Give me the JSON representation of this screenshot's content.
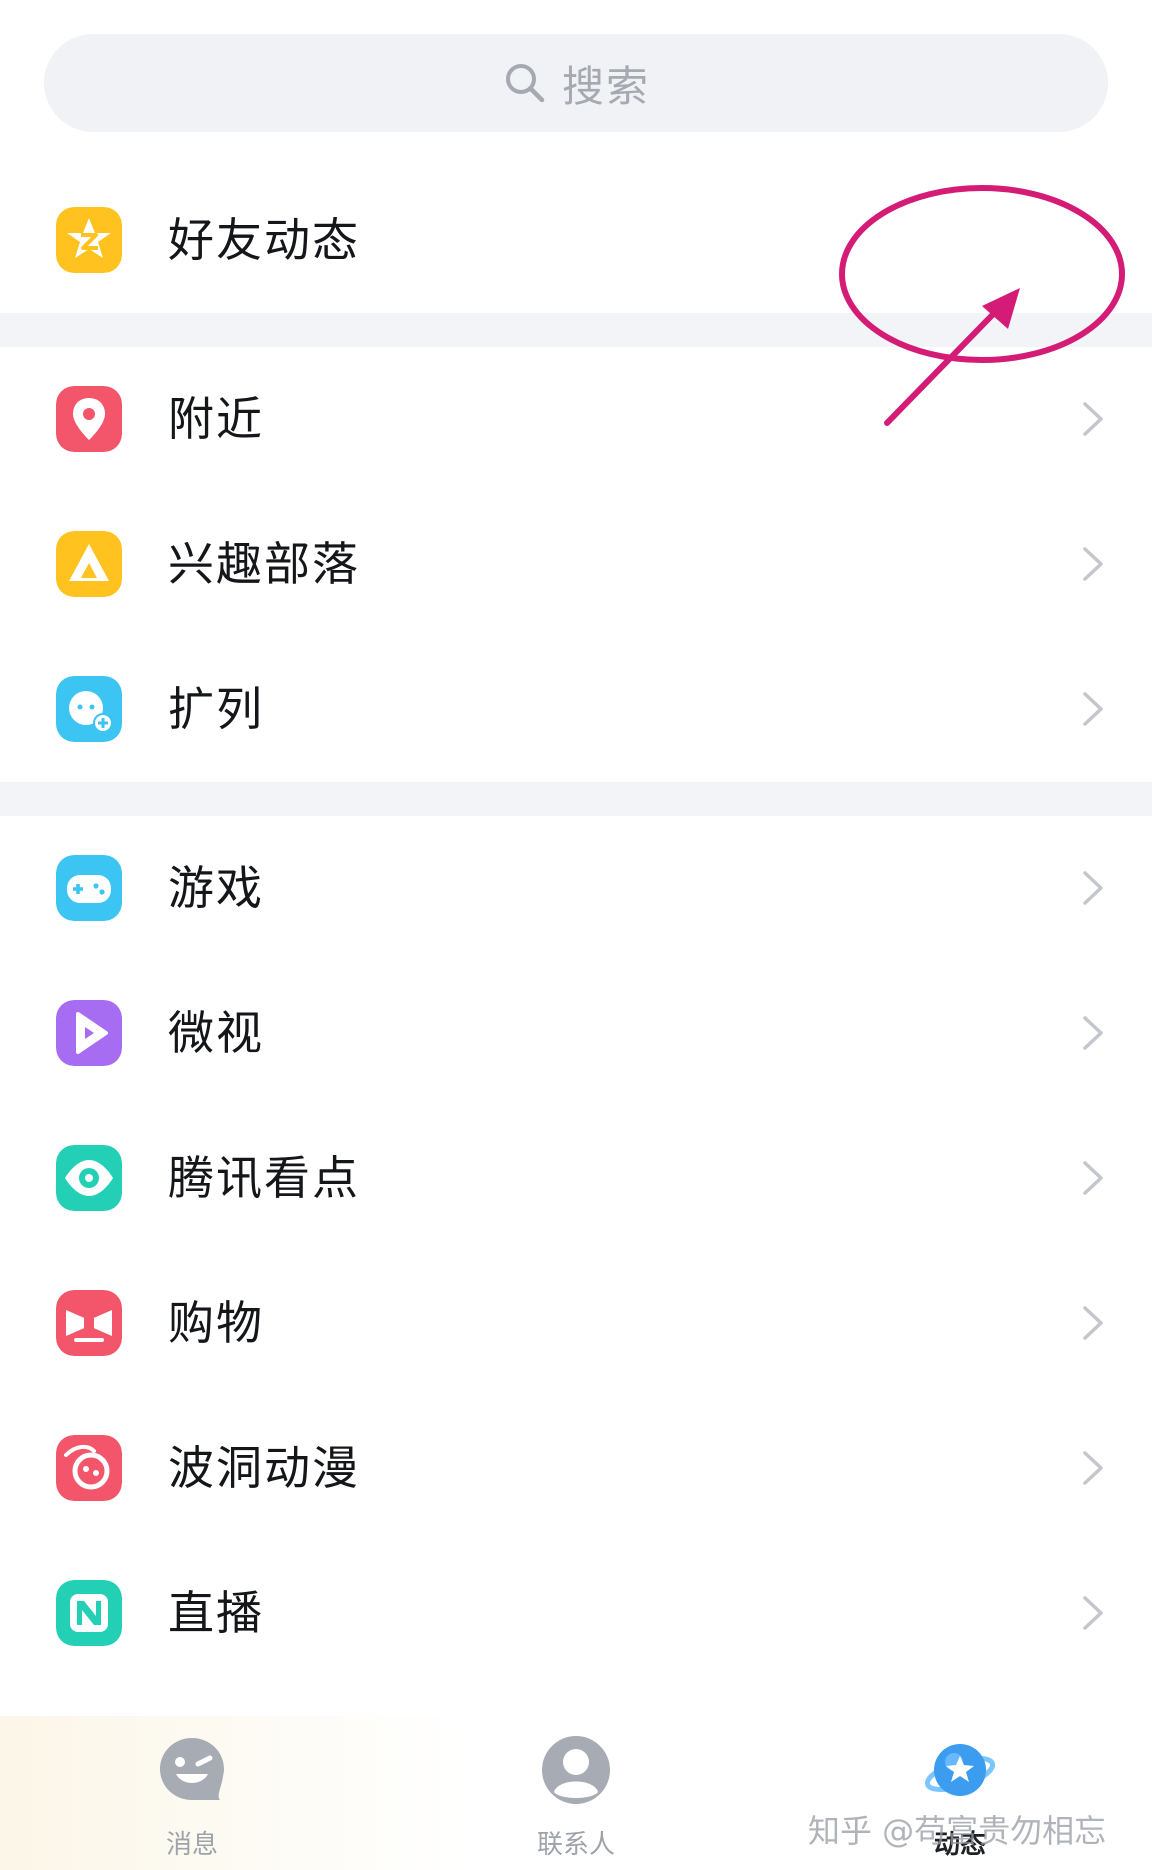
{
  "search": {
    "placeholder": "搜索",
    "icon": "search-icon"
  },
  "items": [
    {
      "label": "好友动态",
      "icon": "star-badge-icon",
      "color": "#FFC21E"
    },
    {
      "label": "附近",
      "icon": "location-pin-icon",
      "color": "#F3566B"
    },
    {
      "label": "兴趣部落",
      "icon": "tent-icon",
      "color": "#FFC21E"
    },
    {
      "label": "扩列",
      "icon": "add-friend-face-icon",
      "color": "#3CC4F2"
    },
    {
      "label": "游戏",
      "icon": "gamepad-icon",
      "color": "#3CC4F2"
    },
    {
      "label": "微视",
      "icon": "play-video-icon",
      "color": "#A66CF2"
    },
    {
      "label": "腾讯看点",
      "icon": "eye-icon",
      "color": "#23D0B5"
    },
    {
      "label": "购物",
      "icon": "shopping-bow-icon",
      "color": "#F3566B"
    },
    {
      "label": "波洞动漫",
      "icon": "anime-icon",
      "color": "#F3566B"
    },
    {
      "label": "直播",
      "icon": "live-n-icon",
      "color": "#23D0B5"
    }
  ],
  "tabbar": {
    "tabs": [
      {
        "label": "消息",
        "icon": "chat-face-icon",
        "active": false
      },
      {
        "label": "联系人",
        "icon": "contact-person-icon",
        "active": false
      },
      {
        "label": "动态",
        "icon": "planet-star-icon",
        "active": true
      }
    ]
  },
  "watermark": "知乎 @苟富贵勿相忘",
  "colors": {
    "annotation": "#D41C76",
    "tab_active": "#3C9CF0",
    "tab_inactive": "#A7ABB3",
    "chevron": "#C3C6CC",
    "separator": "#F3F4F7"
  }
}
